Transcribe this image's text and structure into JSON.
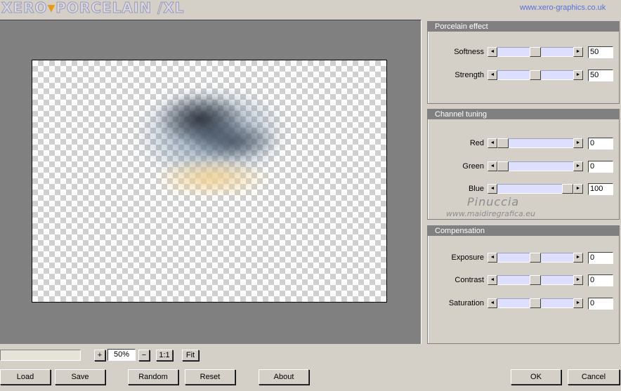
{
  "header": {
    "logo_part1": "XERO",
    "logo_mark": "▼",
    "logo_part2": "PORCELAIN /XL",
    "url": "www.xero-graphics.co.uk"
  },
  "panels": {
    "porcelain": {
      "title": "Porcelain effect",
      "rows": [
        {
          "label": "Softness",
          "value": "50",
          "level": 0.5
        },
        {
          "label": "Strength",
          "value": "50",
          "level": 0.5
        }
      ]
    },
    "channel": {
      "title": "Channel tuning",
      "rows": [
        {
          "label": "Red",
          "value": "0",
          "level": 0.0
        },
        {
          "label": "Green",
          "value": "0",
          "level": 0.0
        },
        {
          "label": "Blue",
          "value": "100",
          "level": 1.0
        }
      ],
      "watermark_name": "Pinuccia",
      "watermark_url": "www.maidiregrafica.eu"
    },
    "compensation": {
      "title": "Compensation",
      "rows": [
        {
          "label": "Exposure",
          "value": "0",
          "level": 0.5
        },
        {
          "label": "Contrast",
          "value": "0",
          "level": 0.5
        },
        {
          "label": "Saturation",
          "value": "0",
          "level": 0.5
        }
      ]
    }
  },
  "zoom": {
    "plus": "+",
    "value": "50%",
    "minus": "−",
    "one_to_one": "1:1",
    "fit": "Fit"
  },
  "buttons": {
    "load": "Load",
    "save": "Save",
    "random": "Random",
    "reset": "Reset",
    "about": "About",
    "ok": "OK",
    "cancel": "Cancel"
  },
  "arrows": {
    "left": "◄",
    "right": "►"
  },
  "colors": {
    "panel_bg": "#d4d0c8",
    "preview_bg": "#808080",
    "track": "#dedeff",
    "url": "#5b6fd6"
  }
}
